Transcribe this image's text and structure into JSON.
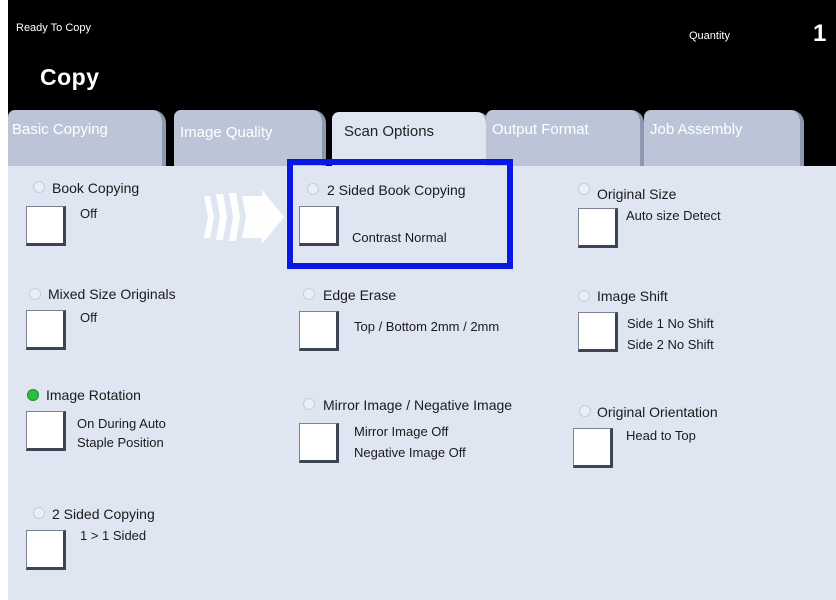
{
  "header": {
    "status": "Ready To Copy",
    "quantity_label": "Quantity",
    "quantity_value": "1",
    "title": "Copy"
  },
  "tabs": [
    {
      "label": "Basic Copying"
    },
    {
      "label": "Image Quality"
    },
    {
      "label": "Scan Options",
      "active": true
    },
    {
      "label": "Output Format"
    },
    {
      "label": "Job Assembly"
    }
  ],
  "options": {
    "book_copying": {
      "label": "Book Copying",
      "value": "Off"
    },
    "two_sided_book_copying": {
      "label": "2 Sided Book Copying",
      "value": "Contrast Normal"
    },
    "original_size": {
      "label": "Original Size",
      "value": "Auto size Detect"
    },
    "mixed_size_originals": {
      "label": "Mixed Size Originals",
      "value": "Off"
    },
    "edge_erase": {
      "label": "Edge Erase",
      "value": "Top / Bottom 2mm / 2mm"
    },
    "image_shift": {
      "label": "Image Shift",
      "value_line1": "Side 1 No Shift",
      "value_line2": "Side 2 No Shift"
    },
    "image_rotation": {
      "label": "Image Rotation",
      "value_line1": "On During Auto",
      "value_line2": "Staple Position",
      "active": true
    },
    "mirror_negative": {
      "label": "Mirror Image / Negative Image",
      "value_line1": "Mirror Image Off",
      "value_line2": "Negative Image Off"
    },
    "original_orientation": {
      "label": "Original Orientation",
      "value": "Head to Top"
    },
    "two_sided_copying": {
      "label": "2 Sided Copying",
      "value": "1 > 1 Sided"
    }
  },
  "colors": {
    "highlight": "#0a18e6",
    "active_radio": "#2fbf3f",
    "panel": "#dfe6f2"
  }
}
